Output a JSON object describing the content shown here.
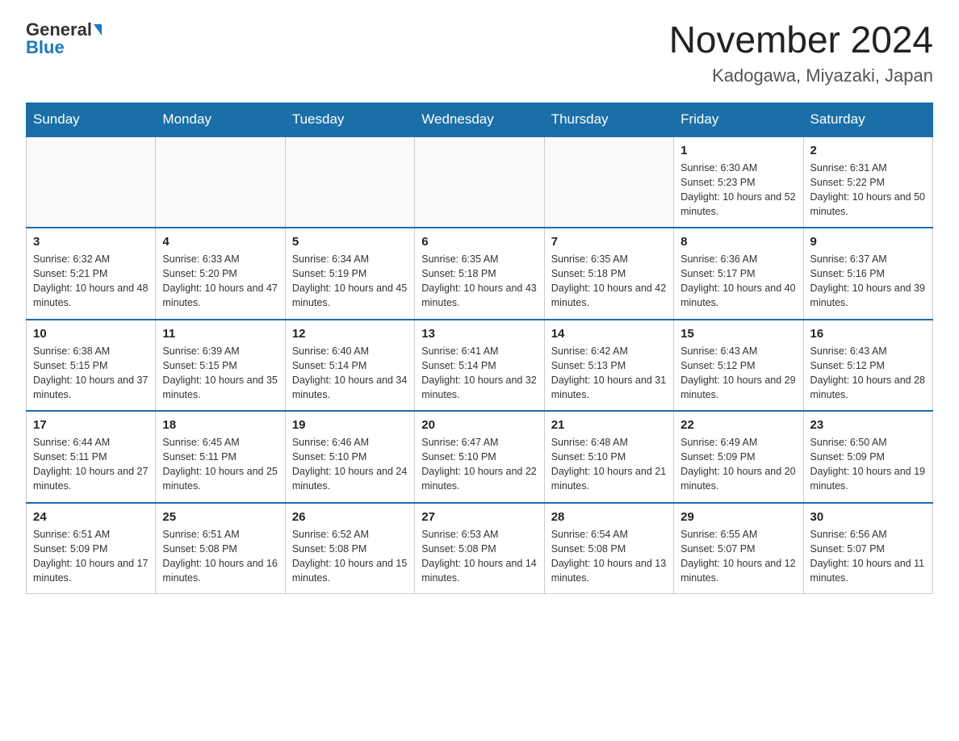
{
  "header": {
    "logo_general": "General",
    "logo_blue": "Blue",
    "month_year": "November 2024",
    "location": "Kadogawa, Miyazaki, Japan"
  },
  "days_of_week": [
    "Sunday",
    "Monday",
    "Tuesday",
    "Wednesday",
    "Thursday",
    "Friday",
    "Saturday"
  ],
  "weeks": [
    [
      {
        "day": "",
        "info": ""
      },
      {
        "day": "",
        "info": ""
      },
      {
        "day": "",
        "info": ""
      },
      {
        "day": "",
        "info": ""
      },
      {
        "day": "",
        "info": ""
      },
      {
        "day": "1",
        "info": "Sunrise: 6:30 AM\nSunset: 5:23 PM\nDaylight: 10 hours and 52 minutes."
      },
      {
        "day": "2",
        "info": "Sunrise: 6:31 AM\nSunset: 5:22 PM\nDaylight: 10 hours and 50 minutes."
      }
    ],
    [
      {
        "day": "3",
        "info": "Sunrise: 6:32 AM\nSunset: 5:21 PM\nDaylight: 10 hours and 48 minutes."
      },
      {
        "day": "4",
        "info": "Sunrise: 6:33 AM\nSunset: 5:20 PM\nDaylight: 10 hours and 47 minutes."
      },
      {
        "day": "5",
        "info": "Sunrise: 6:34 AM\nSunset: 5:19 PM\nDaylight: 10 hours and 45 minutes."
      },
      {
        "day": "6",
        "info": "Sunrise: 6:35 AM\nSunset: 5:18 PM\nDaylight: 10 hours and 43 minutes."
      },
      {
        "day": "7",
        "info": "Sunrise: 6:35 AM\nSunset: 5:18 PM\nDaylight: 10 hours and 42 minutes."
      },
      {
        "day": "8",
        "info": "Sunrise: 6:36 AM\nSunset: 5:17 PM\nDaylight: 10 hours and 40 minutes."
      },
      {
        "day": "9",
        "info": "Sunrise: 6:37 AM\nSunset: 5:16 PM\nDaylight: 10 hours and 39 minutes."
      }
    ],
    [
      {
        "day": "10",
        "info": "Sunrise: 6:38 AM\nSunset: 5:15 PM\nDaylight: 10 hours and 37 minutes."
      },
      {
        "day": "11",
        "info": "Sunrise: 6:39 AM\nSunset: 5:15 PM\nDaylight: 10 hours and 35 minutes."
      },
      {
        "day": "12",
        "info": "Sunrise: 6:40 AM\nSunset: 5:14 PM\nDaylight: 10 hours and 34 minutes."
      },
      {
        "day": "13",
        "info": "Sunrise: 6:41 AM\nSunset: 5:14 PM\nDaylight: 10 hours and 32 minutes."
      },
      {
        "day": "14",
        "info": "Sunrise: 6:42 AM\nSunset: 5:13 PM\nDaylight: 10 hours and 31 minutes."
      },
      {
        "day": "15",
        "info": "Sunrise: 6:43 AM\nSunset: 5:12 PM\nDaylight: 10 hours and 29 minutes."
      },
      {
        "day": "16",
        "info": "Sunrise: 6:43 AM\nSunset: 5:12 PM\nDaylight: 10 hours and 28 minutes."
      }
    ],
    [
      {
        "day": "17",
        "info": "Sunrise: 6:44 AM\nSunset: 5:11 PM\nDaylight: 10 hours and 27 minutes."
      },
      {
        "day": "18",
        "info": "Sunrise: 6:45 AM\nSunset: 5:11 PM\nDaylight: 10 hours and 25 minutes."
      },
      {
        "day": "19",
        "info": "Sunrise: 6:46 AM\nSunset: 5:10 PM\nDaylight: 10 hours and 24 minutes."
      },
      {
        "day": "20",
        "info": "Sunrise: 6:47 AM\nSunset: 5:10 PM\nDaylight: 10 hours and 22 minutes."
      },
      {
        "day": "21",
        "info": "Sunrise: 6:48 AM\nSunset: 5:10 PM\nDaylight: 10 hours and 21 minutes."
      },
      {
        "day": "22",
        "info": "Sunrise: 6:49 AM\nSunset: 5:09 PM\nDaylight: 10 hours and 20 minutes."
      },
      {
        "day": "23",
        "info": "Sunrise: 6:50 AM\nSunset: 5:09 PM\nDaylight: 10 hours and 19 minutes."
      }
    ],
    [
      {
        "day": "24",
        "info": "Sunrise: 6:51 AM\nSunset: 5:09 PM\nDaylight: 10 hours and 17 minutes."
      },
      {
        "day": "25",
        "info": "Sunrise: 6:51 AM\nSunset: 5:08 PM\nDaylight: 10 hours and 16 minutes."
      },
      {
        "day": "26",
        "info": "Sunrise: 6:52 AM\nSunset: 5:08 PM\nDaylight: 10 hours and 15 minutes."
      },
      {
        "day": "27",
        "info": "Sunrise: 6:53 AM\nSunset: 5:08 PM\nDaylight: 10 hours and 14 minutes."
      },
      {
        "day": "28",
        "info": "Sunrise: 6:54 AM\nSunset: 5:08 PM\nDaylight: 10 hours and 13 minutes."
      },
      {
        "day": "29",
        "info": "Sunrise: 6:55 AM\nSunset: 5:07 PM\nDaylight: 10 hours and 12 minutes."
      },
      {
        "day": "30",
        "info": "Sunrise: 6:56 AM\nSunset: 5:07 PM\nDaylight: 10 hours and 11 minutes."
      }
    ]
  ]
}
